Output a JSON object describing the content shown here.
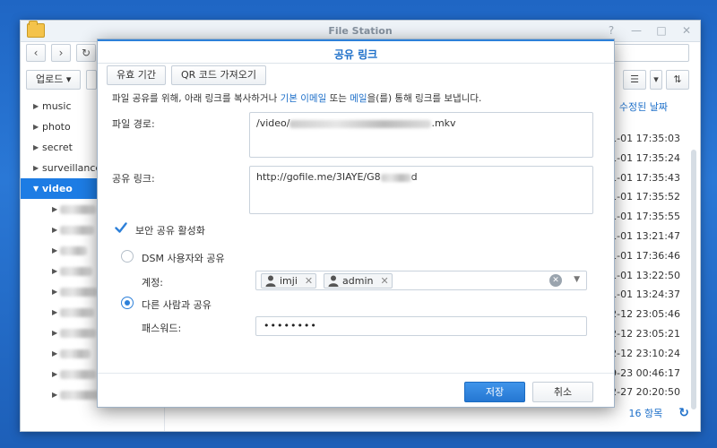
{
  "window": {
    "title": "File Station",
    "toolbar": {
      "upload_label": "업로드"
    },
    "sidebar": {
      "items": [
        {
          "label": "music"
        },
        {
          "label": "photo"
        },
        {
          "label": "secret"
        },
        {
          "label": "surveillance"
        },
        {
          "label": "video",
          "selected": true
        }
      ]
    },
    "list": {
      "modified_header": "수정된 날짜",
      "dates": [
        "1-01 17:35:03",
        "1-01 17:35:24",
        "1-01 17:35:43",
        "1-01 17:35:52",
        "1-01 17:35:55",
        "1-01 13:21:47",
        "1-01 17:36:46",
        "1-01 13:22:50",
        "1-01 13:24:37",
        "2-12 23:05:46",
        "2-12 23:05:21",
        "2-12 23:10:24",
        "9-23 00:46:17",
        "2-27 20:20:50"
      ],
      "item_count": "16 항목"
    }
  },
  "dialog": {
    "title": "공유 링크",
    "tabs": [
      "유효 기간",
      "QR 코드 가져오기"
    ],
    "description": {
      "part1": "파일 공유를 위해, 아래 링크를 복사하거나 ",
      "link1": "기본 이메일",
      "part2": " 또는 ",
      "link2": "메일",
      "part3": "을(를) 통해 링크를 보냅니다."
    },
    "file_path_label": "파일 경로:",
    "file_path_prefix": "/video/",
    "file_path_suffix": ".mkv",
    "share_link_label": "공유 링크:",
    "share_link_prefix": "http://gofile.me/3IAYE/G8",
    "share_link_suffix": "d",
    "secure_share_label": "보안 공유 활성화",
    "secure_share_checked": true,
    "dsm_share_label": "DSM 사용자와 공유",
    "account_label": "계정:",
    "accounts": [
      "imji",
      "admin"
    ],
    "others_share_label": "다른 사람과 공유",
    "password_label": "패스워드:",
    "password_value": "••••••••",
    "save_label": "저장",
    "cancel_label": "취소",
    "accent_color": "#2d80d9"
  }
}
